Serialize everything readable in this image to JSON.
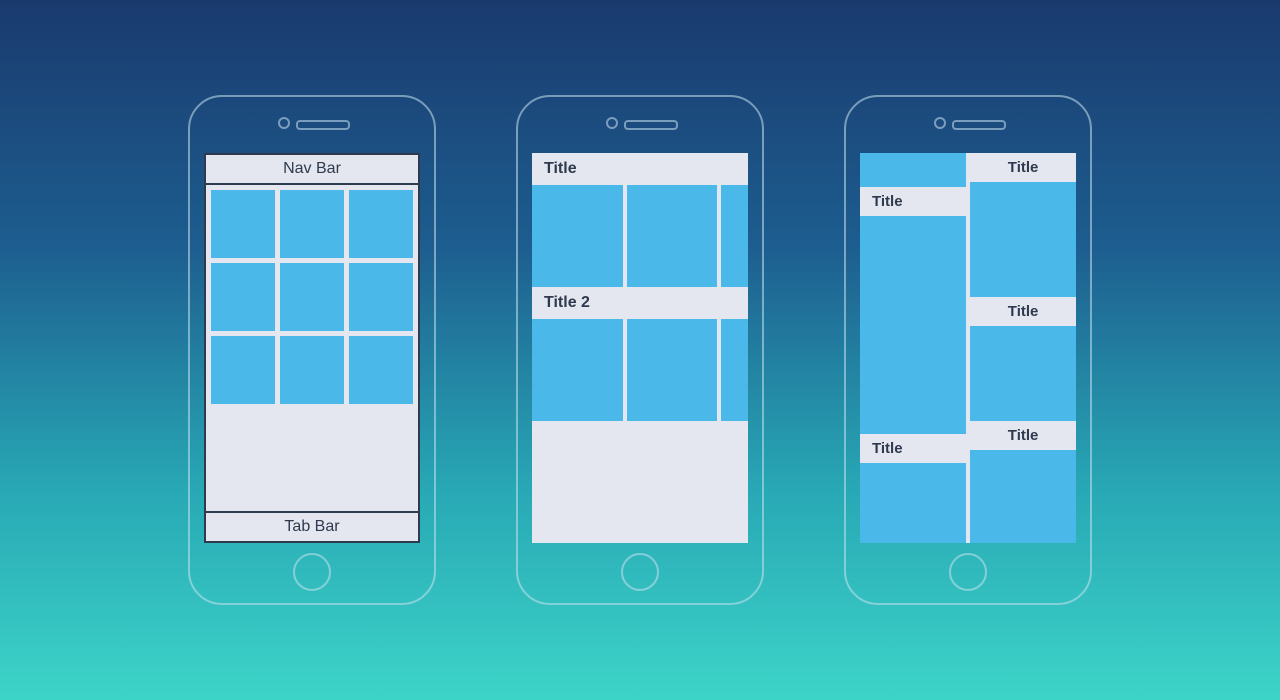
{
  "phone1": {
    "nav_label": "Nav Bar",
    "tab_label": "Tab Bar"
  },
  "phone2": {
    "section1_title": "Title",
    "section2_title": "Title 2"
  },
  "phone3": {
    "left_title1": "Title",
    "left_title2": "Title",
    "right_title1": "Title",
    "right_title2": "Title",
    "right_title3": "Title"
  }
}
